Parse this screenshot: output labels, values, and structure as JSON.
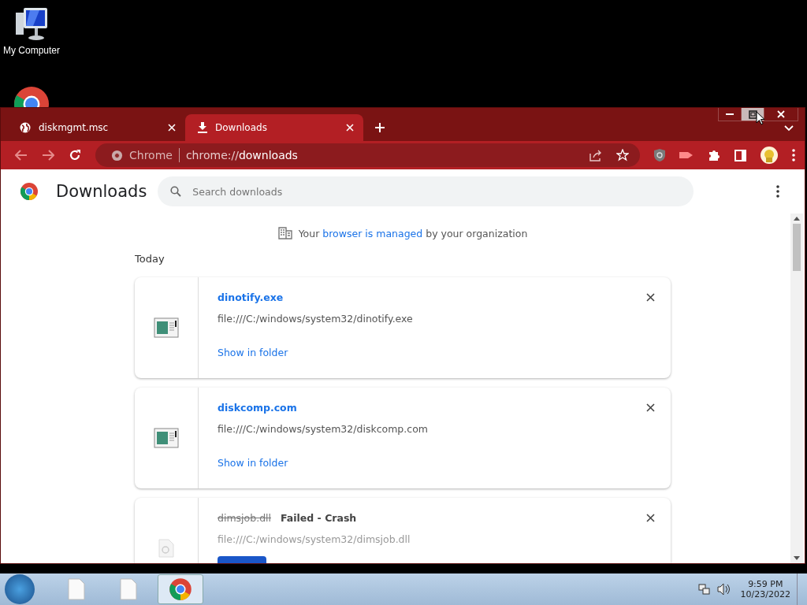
{
  "desktop_icons": [
    {
      "kind": "computer",
      "label": "My Computer"
    },
    {
      "kind": "chrome"
    }
  ],
  "browser": {
    "tabs": [
      {
        "title": "diskmgmt.msc",
        "kind": "page",
        "selected": false
      },
      {
        "title": "Downloads",
        "kind": "download",
        "selected": true
      }
    ],
    "address": {
      "scheme": "Chrome",
      "url": "chrome://**downloads**"
    },
    "page": {
      "title": "Downloads",
      "search": {
        "placeholder": "Search downloads"
      },
      "notice": {
        "before": "Your",
        "link": "browser is managed",
        "after": "by your organization"
      },
      "section": "Today",
      "items": [
        {
          "name": "dinotify.exe",
          "path": "file:///C:/windows/system32/dinotify.exe",
          "action": "Show in folder",
          "failed": false
        },
        {
          "name": "diskcomp.com",
          "path": "file:///C:/windows/system32/diskcomp.com",
          "action": "Show in folder",
          "failed": false
        },
        {
          "name": "dimsjob.dll",
          "path": "file:///C:/windows/system32/dimsjob.dll",
          "status": "Failed - Crash",
          "failed": true
        }
      ]
    }
  },
  "taskbar": {
    "items": [
      {
        "kind": "file",
        "selected": false
      },
      {
        "kind": "file",
        "selected": false
      },
      {
        "kind": "chrome",
        "selected": true
      }
    ],
    "time": "9:59 PM",
    "date": "10/23/2022"
  }
}
